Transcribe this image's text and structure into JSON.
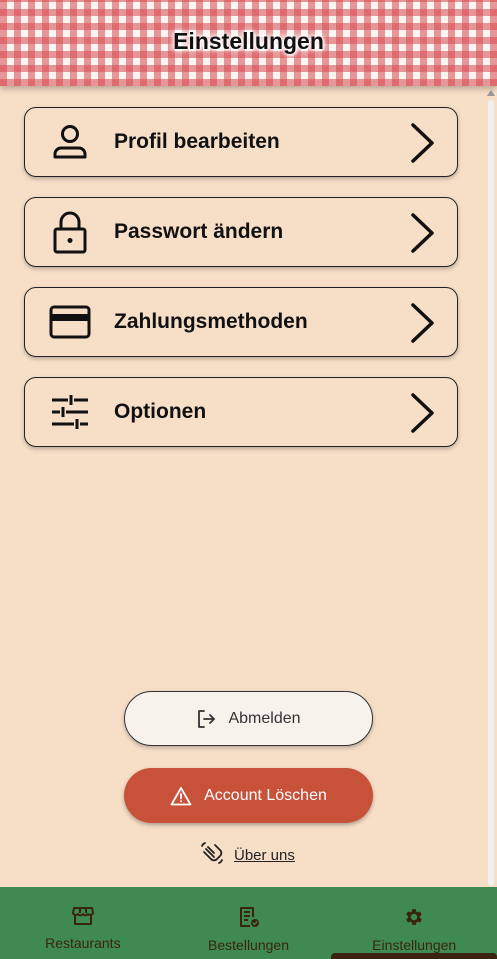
{
  "header": {
    "title": "Einstellungen"
  },
  "menu": [
    {
      "label": "Profil bearbeiten",
      "icon": "person-icon"
    },
    {
      "label": "Passwort ändern",
      "icon": "lock-icon"
    },
    {
      "label": "Zahlungsmethoden",
      "icon": "credit-card-icon"
    },
    {
      "label": "Optionen",
      "icon": "sliders-icon"
    }
  ],
  "actions": {
    "logout_label": "Abmelden",
    "delete_label": "Account Löschen",
    "about_label": "Über uns"
  },
  "nav": [
    {
      "label": "Restaurants",
      "icon": "storefront-icon"
    },
    {
      "label": "Bestellungen",
      "icon": "order-list-icon"
    },
    {
      "label": "Einstellungen",
      "icon": "gear-icon",
      "active": true
    }
  ],
  "colors": {
    "background": "#f7dfc7",
    "header_check": "#d6484e",
    "delete_button": "#c8513a",
    "nav_bar": "#3e8a52",
    "nav_text": "#3a2410"
  }
}
